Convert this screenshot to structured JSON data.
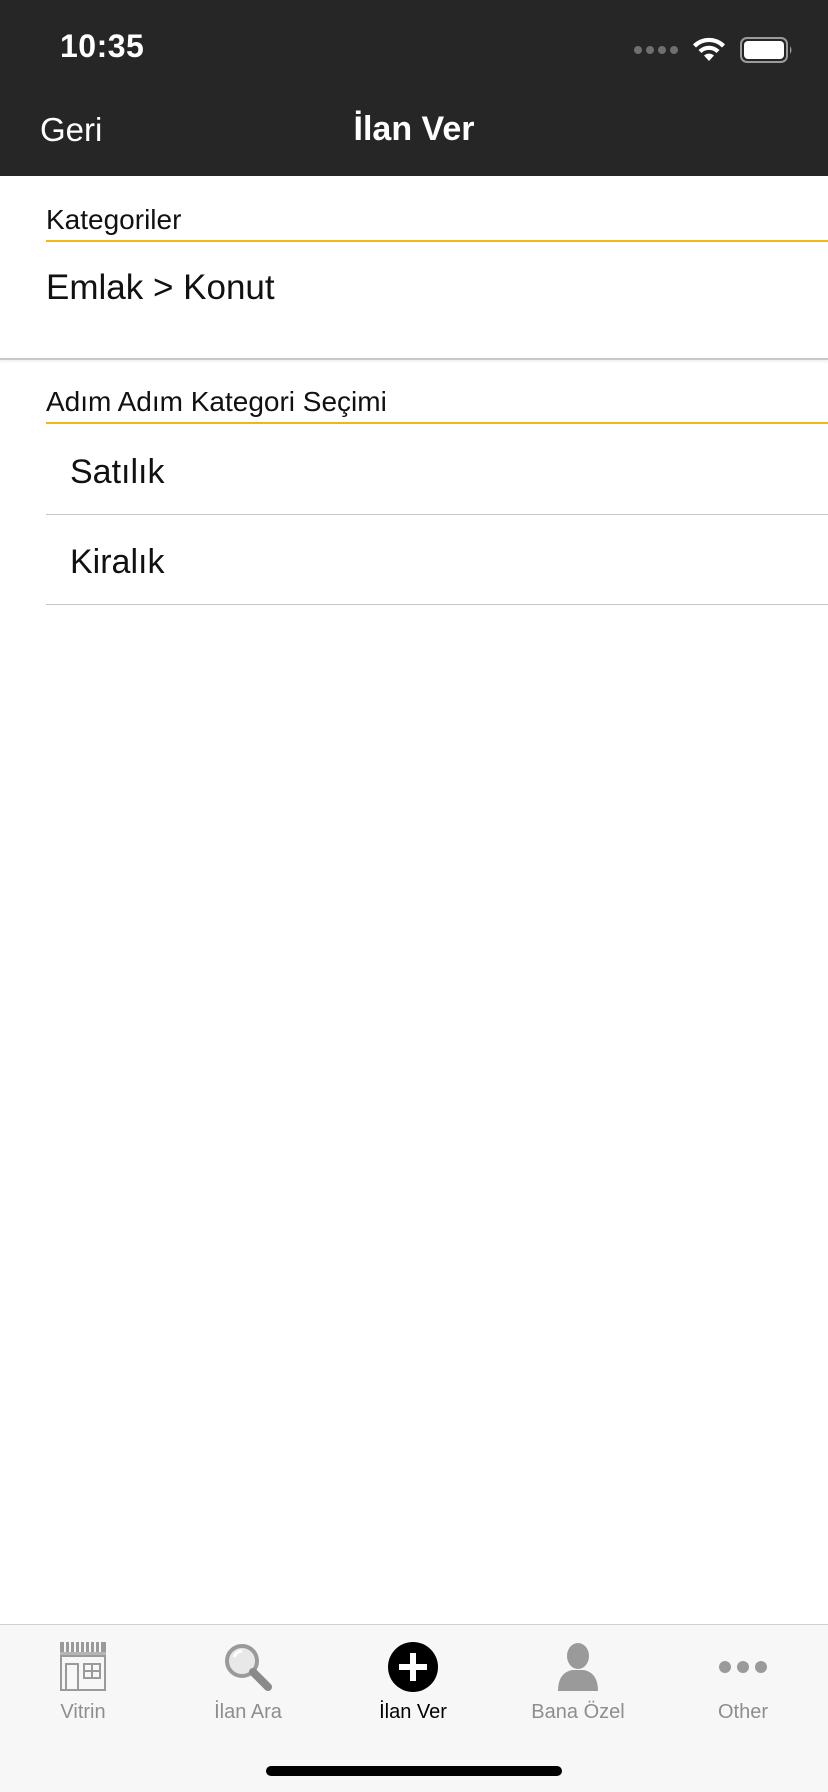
{
  "status_bar": {
    "time": "10:35"
  },
  "nav": {
    "back_label": "Geri",
    "title": "İlan Ver"
  },
  "categories": {
    "heading": "Kategoriler",
    "selected_path": "Emlak > Konut"
  },
  "step_selection": {
    "heading": "Adım Adım Kategori Seçimi",
    "items": [
      {
        "label": "Satılık"
      },
      {
        "label": "Kiralık"
      }
    ]
  },
  "tab_bar": {
    "tabs": [
      {
        "label": "Vitrin",
        "icon": "storefront-icon"
      },
      {
        "label": "İlan Ara",
        "icon": "search-icon"
      },
      {
        "label": "İlan Ver",
        "icon": "plus-circle-icon",
        "active": true
      },
      {
        "label": "Bana Özel",
        "icon": "person-icon"
      },
      {
        "label": "Other",
        "icon": "more-dots-icon"
      }
    ]
  },
  "colors": {
    "header_background": "#262626",
    "accent": "#f2b61b",
    "tab_inactive": "#8e8e8e",
    "tab_active": "#000000"
  }
}
